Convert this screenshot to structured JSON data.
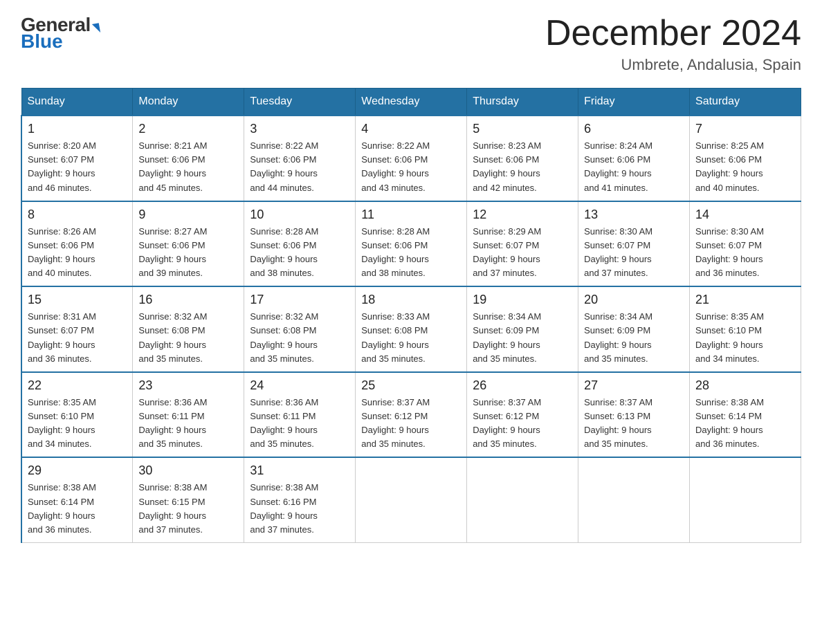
{
  "logo": {
    "general": "General",
    "blue": "Blue"
  },
  "title": {
    "month": "December 2024",
    "location": "Umbrete, Andalusia, Spain"
  },
  "weekdays": [
    "Sunday",
    "Monday",
    "Tuesday",
    "Wednesday",
    "Thursday",
    "Friday",
    "Saturday"
  ],
  "weeks": [
    [
      {
        "day": "1",
        "sunrise": "8:20 AM",
        "sunset": "6:07 PM",
        "daylight": "9 hours and 46 minutes."
      },
      {
        "day": "2",
        "sunrise": "8:21 AM",
        "sunset": "6:06 PM",
        "daylight": "9 hours and 45 minutes."
      },
      {
        "day": "3",
        "sunrise": "8:22 AM",
        "sunset": "6:06 PM",
        "daylight": "9 hours and 44 minutes."
      },
      {
        "day": "4",
        "sunrise": "8:22 AM",
        "sunset": "6:06 PM",
        "daylight": "9 hours and 43 minutes."
      },
      {
        "day": "5",
        "sunrise": "8:23 AM",
        "sunset": "6:06 PM",
        "daylight": "9 hours and 42 minutes."
      },
      {
        "day": "6",
        "sunrise": "8:24 AM",
        "sunset": "6:06 PM",
        "daylight": "9 hours and 41 minutes."
      },
      {
        "day": "7",
        "sunrise": "8:25 AM",
        "sunset": "6:06 PM",
        "daylight": "9 hours and 40 minutes."
      }
    ],
    [
      {
        "day": "8",
        "sunrise": "8:26 AM",
        "sunset": "6:06 PM",
        "daylight": "9 hours and 40 minutes."
      },
      {
        "day": "9",
        "sunrise": "8:27 AM",
        "sunset": "6:06 PM",
        "daylight": "9 hours and 39 minutes."
      },
      {
        "day": "10",
        "sunrise": "8:28 AM",
        "sunset": "6:06 PM",
        "daylight": "9 hours and 38 minutes."
      },
      {
        "day": "11",
        "sunrise": "8:28 AM",
        "sunset": "6:06 PM",
        "daylight": "9 hours and 38 minutes."
      },
      {
        "day": "12",
        "sunrise": "8:29 AM",
        "sunset": "6:07 PM",
        "daylight": "9 hours and 37 minutes."
      },
      {
        "day": "13",
        "sunrise": "8:30 AM",
        "sunset": "6:07 PM",
        "daylight": "9 hours and 37 minutes."
      },
      {
        "day": "14",
        "sunrise": "8:30 AM",
        "sunset": "6:07 PM",
        "daylight": "9 hours and 36 minutes."
      }
    ],
    [
      {
        "day": "15",
        "sunrise": "8:31 AM",
        "sunset": "6:07 PM",
        "daylight": "9 hours and 36 minutes."
      },
      {
        "day": "16",
        "sunrise": "8:32 AM",
        "sunset": "6:08 PM",
        "daylight": "9 hours and 35 minutes."
      },
      {
        "day": "17",
        "sunrise": "8:32 AM",
        "sunset": "6:08 PM",
        "daylight": "9 hours and 35 minutes."
      },
      {
        "day": "18",
        "sunrise": "8:33 AM",
        "sunset": "6:08 PM",
        "daylight": "9 hours and 35 minutes."
      },
      {
        "day": "19",
        "sunrise": "8:34 AM",
        "sunset": "6:09 PM",
        "daylight": "9 hours and 35 minutes."
      },
      {
        "day": "20",
        "sunrise": "8:34 AM",
        "sunset": "6:09 PM",
        "daylight": "9 hours and 35 minutes."
      },
      {
        "day": "21",
        "sunrise": "8:35 AM",
        "sunset": "6:10 PM",
        "daylight": "9 hours and 34 minutes."
      }
    ],
    [
      {
        "day": "22",
        "sunrise": "8:35 AM",
        "sunset": "6:10 PM",
        "daylight": "9 hours and 34 minutes."
      },
      {
        "day": "23",
        "sunrise": "8:36 AM",
        "sunset": "6:11 PM",
        "daylight": "9 hours and 35 minutes."
      },
      {
        "day": "24",
        "sunrise": "8:36 AM",
        "sunset": "6:11 PM",
        "daylight": "9 hours and 35 minutes."
      },
      {
        "day": "25",
        "sunrise": "8:37 AM",
        "sunset": "6:12 PM",
        "daylight": "9 hours and 35 minutes."
      },
      {
        "day": "26",
        "sunrise": "8:37 AM",
        "sunset": "6:12 PM",
        "daylight": "9 hours and 35 minutes."
      },
      {
        "day": "27",
        "sunrise": "8:37 AM",
        "sunset": "6:13 PM",
        "daylight": "9 hours and 35 minutes."
      },
      {
        "day": "28",
        "sunrise": "8:38 AM",
        "sunset": "6:14 PM",
        "daylight": "9 hours and 36 minutes."
      }
    ],
    [
      {
        "day": "29",
        "sunrise": "8:38 AM",
        "sunset": "6:14 PM",
        "daylight": "9 hours and 36 minutes."
      },
      {
        "day": "30",
        "sunrise": "8:38 AM",
        "sunset": "6:15 PM",
        "daylight": "9 hours and 37 minutes."
      },
      {
        "day": "31",
        "sunrise": "8:38 AM",
        "sunset": "6:16 PM",
        "daylight": "9 hours and 37 minutes."
      },
      null,
      null,
      null,
      null
    ]
  ]
}
